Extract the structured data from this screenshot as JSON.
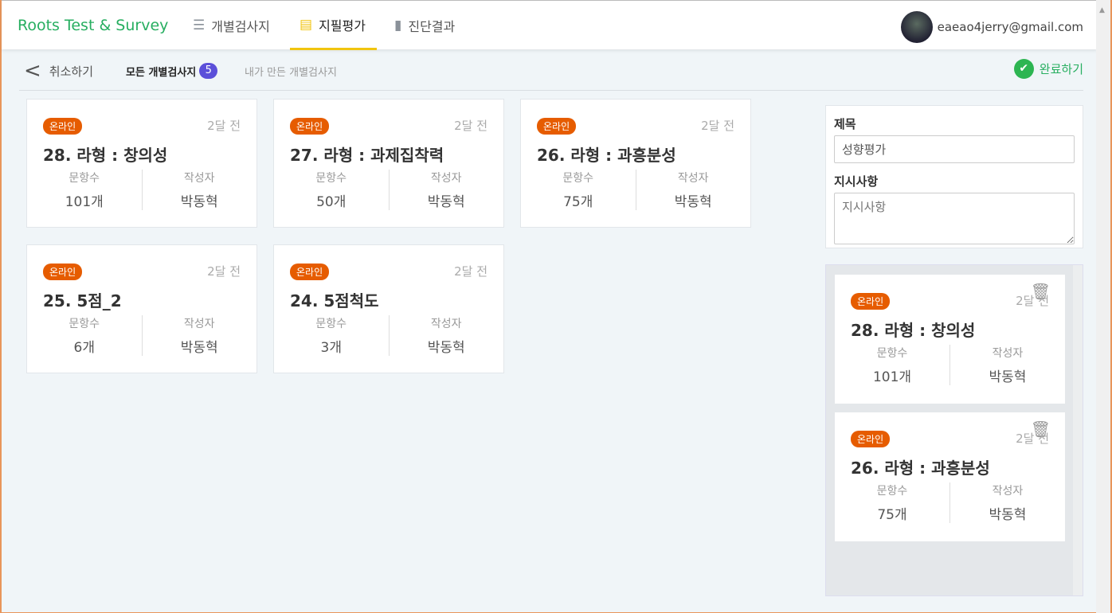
{
  "header": {
    "logo": "Roots Test & Survey",
    "nav": [
      {
        "label": "개별검사지",
        "icon": "list-icon"
      },
      {
        "label": "지필평가",
        "icon": "document-icon",
        "active": true
      },
      {
        "label": "진단결과",
        "icon": "bar-chart-icon"
      }
    ],
    "user_email": "eaeao4jerry@gmail.com"
  },
  "subnav": {
    "cancel": "취소하기",
    "tab_all": "모든 개별검사지",
    "tab_all_count": "5",
    "tab_mine": "내가 만든 개별검사지",
    "complete": "완료하기"
  },
  "colors": {
    "accent_green": "#27ae60",
    "tab_underline": "#f1c40f",
    "badge": "#5b4fd9",
    "online_pill": "#e65c00"
  },
  "labels": {
    "items": "문항수",
    "author": "작성자"
  },
  "cards": [
    {
      "badge": "온라인",
      "ago": "2달 전",
      "title": "28. 라형 : 창의성",
      "items": "101개",
      "author": "박동혁"
    },
    {
      "badge": "온라인",
      "ago": "2달 전",
      "title": "27. 라형 : 과제집착력",
      "items": "50개",
      "author": "박동혁"
    },
    {
      "badge": "온라인",
      "ago": "2달 전",
      "title": "26. 라형 : 과흥분성",
      "items": "75개",
      "author": "박동혁"
    },
    {
      "badge": "온라인",
      "ago": "2달 전",
      "title": "25. 5점_2",
      "items": "6개",
      "author": "박동혁"
    },
    {
      "badge": "온라인",
      "ago": "2달 전",
      "title": "24. 5점척도",
      "items": "3개",
      "author": "박동혁"
    }
  ],
  "form": {
    "title_label": "제목",
    "title_value": "성향평가",
    "instr_label": "지시사항",
    "instr_placeholder": "지시사항"
  },
  "selected": [
    {
      "badge": "온라인",
      "ago": "2달 전",
      "title": "28. 라형 : 창의성",
      "items": "101개",
      "author": "박동혁"
    },
    {
      "badge": "온라인",
      "ago": "2달 전",
      "title": "26. 라형 : 과흥분성",
      "items": "75개",
      "author": "박동혁"
    }
  ]
}
